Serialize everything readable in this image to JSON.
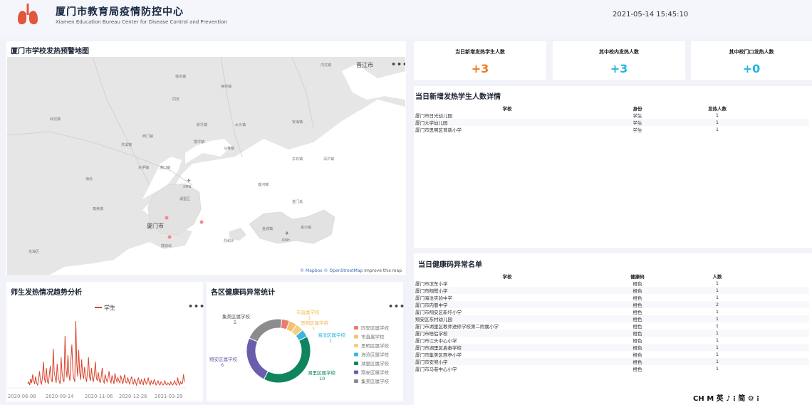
{
  "header": {
    "title": "厦门市教育局疫情防控中心",
    "subtitle": "Xiamen Education Bureau Center for Disease Control and Prevention",
    "datetime": "2021-05-14 15:45:10"
  },
  "map": {
    "title": "厦门市学校发热预警地图",
    "menu": "•••",
    "labels": {
      "xiamen": "厦门市",
      "jinjiang": "晋江市",
      "xm_airport": "XMN",
      "kinmen_airport": "KNH",
      "kinmen": "金门岛",
      "jinsha": "金沙镇",
      "jincheng": "金城镇",
      "lieyu": "烈屿乡",
      "huli": "湖里区",
      "lianhe": "莲河镇",
      "anhai": "安海镇",
      "dongshi": "东石镇",
      "shuitou": "水头镇",
      "neikeng": "内坑镇",
      "guanqiao": "官桥镇",
      "maxiang": "马巷镇",
      "xinwei": "新圩镇",
      "dongfu": "东孚镇",
      "guankou": "灌口镇",
      "jiaomei": "角美镇",
      "haicang": "海沧",
      "gulang": "鼓浪屿",
      "lingbian": "岭兜镇",
      "tongan": "同安",
      "lianhua": "莲花镇",
      "xiangping": "香坪镇",
      "ximen": "西门镇",
      "gongxi": "洪溪镇",
      "shenhu": "深沪镇",
      "longhai": "龙海区"
    },
    "attribution_mapbox": "© Mapbox",
    "attribution_osm": "© OpenStreetMap",
    "attribution_improve": "Improve this map",
    "colors": {
      "water": "#ffffff",
      "land": "#e6e6e6",
      "alert": "#ef8a8a"
    }
  },
  "stats": [
    {
      "label": "当日新增发热学生人数",
      "value": "+3",
      "color": "#f07c1e"
    },
    {
      "label": "其中校内发热人数",
      "value": "+3",
      "color": "#27b6de"
    },
    {
      "label": "其中校门口发热人数",
      "value": "+0",
      "color": "#27b6de"
    }
  ],
  "fever_table": {
    "title": "当日新增发热学生人数详情",
    "columns": [
      "学校",
      "身份",
      "发热人数"
    ],
    "rows": [
      [
        "厦门市日光幼儿园",
        "学生",
        "1"
      ],
      [
        "厦门大学幼儿园",
        "学生",
        "1"
      ],
      [
        "厦门市思明区育新小学",
        "学生",
        "1"
      ]
    ]
  },
  "health_table": {
    "title": "当日健康码异常名单",
    "columns": [
      "学校",
      "健康码",
      "人数"
    ],
    "rows": [
      [
        "厦门市滨东小学",
        "橙色",
        "1"
      ],
      [
        "厦门市翔鹭小学",
        "橙色",
        "1"
      ],
      [
        "厦门海沧实验中学",
        "橙色",
        "1"
      ],
      [
        "厦门市内厝中学",
        "橙色",
        "2"
      ],
      [
        "厦门市翔安区新圩小学",
        "橙色",
        "1"
      ],
      [
        "翔安区东村幼儿园",
        "橙色",
        "1"
      ],
      [
        "厦门市湖里区教师进修学校第二附属小学",
        "橙色",
        "1"
      ],
      [
        "厦门市梧侣学校",
        "橙色",
        "1"
      ],
      [
        "厦门市江头中心小学",
        "橙色",
        "1"
      ],
      [
        "厦门市湖里区启泰学校",
        "橙色",
        "1"
      ],
      [
        "厦门市集美区西亭小学",
        "橙色",
        "1"
      ],
      [
        "厦门市安兜小学",
        "橙色",
        "1"
      ],
      [
        "厦门市马巷中心小学",
        "橙色",
        "1"
      ]
    ]
  },
  "trend": {
    "title": "师生发热情况趋势分析",
    "menu": "•••",
    "legend": "学生",
    "color": "#d9442e"
  },
  "code_chart": {
    "title": "各区健康码异常统计",
    "menu": "•••"
  },
  "chart_data": [
    {
      "type": "line",
      "title": "师生发热情况趋势分析",
      "series": [
        {
          "name": "学生",
          "values": [
            3,
            5,
            2,
            8,
            4,
            12,
            6,
            3,
            10,
            4,
            2,
            7,
            15,
            5,
            3,
            9,
            24,
            8,
            4,
            18,
            6,
            3,
            12,
            20,
            7,
            5,
            36,
            14,
            9,
            4,
            22,
            11,
            6,
            3,
            28,
            13,
            7,
            5,
            48,
            18,
            9,
            30,
            12,
            6,
            25,
            40,
            15,
            8,
            5,
            62,
            22,
            10,
            35,
            14,
            7,
            26,
            12,
            8,
            19,
            9,
            5,
            15,
            28,
            10,
            6,
            18,
            8,
            5,
            12,
            24,
            9,
            6,
            14,
            7,
            4,
            10,
            18,
            6,
            4,
            12,
            8,
            5,
            9,
            15,
            6,
            4,
            11,
            7,
            3,
            13,
            8,
            5,
            9,
            6,
            4,
            11,
            7,
            3,
            8,
            12,
            5,
            4,
            9,
            6,
            3,
            7,
            10,
            4,
            3,
            8,
            5,
            2,
            6,
            9,
            4,
            3,
            7,
            5,
            2,
            8,
            6,
            3,
            5,
            9,
            4,
            2,
            6,
            4,
            3,
            7,
            5,
            2,
            4,
            6,
            3,
            2,
            5,
            4,
            2,
            3,
            6,
            3,
            2,
            4,
            3,
            2,
            5,
            3,
            2,
            4,
            6,
            3,
            2,
            9,
            4,
            2,
            5,
            3,
            4,
            12,
            5
          ]
        }
      ],
      "x_tick_labels": [
        "2020-06-08",
        "2020-09-14",
        "2020-11-06",
        "2020-12-26",
        "2021-03-29"
      ]
    },
    {
      "type": "pie",
      "title": "各区健康码异常统计",
      "slices": [
        {
          "name": "同安区属学校",
          "value": 1,
          "color": "#e87e6e"
        },
        {
          "name": "市直属学校",
          "value": 1,
          "color": "#f7bf75"
        },
        {
          "name": "思明区属学校",
          "value": 1,
          "color": "#f0d27a"
        },
        {
          "name": "海沧区属学校",
          "value": 1,
          "color": "#3bb6e0"
        },
        {
          "name": "湖里区属学校",
          "value": 10,
          "color": "#10845e"
        },
        {
          "name": "翔安区属学校",
          "value": 6,
          "color": "#6a5dab"
        },
        {
          "name": "集美区属学校",
          "value": 5,
          "color": "#8c8c8c"
        }
      ],
      "data_labels": [
        {
          "name": "市直属学校",
          "value": "1"
        },
        {
          "name": "思明区属学校",
          "value": "1"
        },
        {
          "name": "海沧区属学校",
          "value": "1"
        },
        {
          "name": "湖里区属学校",
          "value": "10"
        },
        {
          "name": "翔安区属学校",
          "value": "6"
        },
        {
          "name": "集美区属学校",
          "value": "5"
        }
      ]
    }
  ],
  "ime": "CH M 英 ♪ ⁝ 简 ⚙ ⁝"
}
